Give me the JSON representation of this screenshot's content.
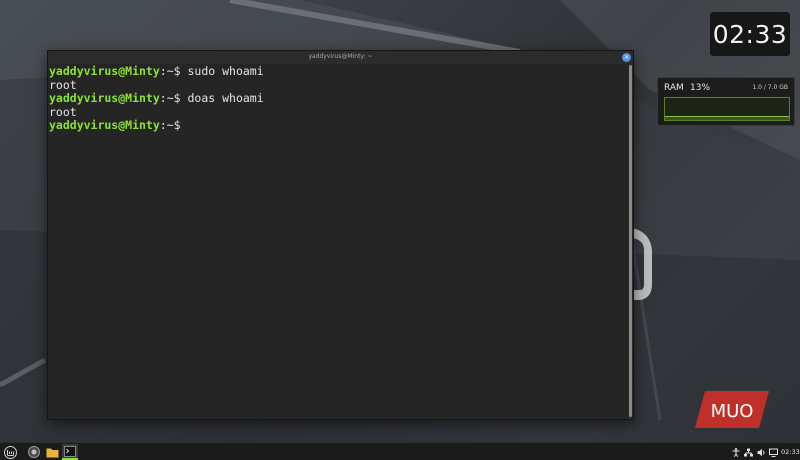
{
  "desktop": {
    "clock_widget": {
      "time": "02:33"
    },
    "ram_widget": {
      "label": "RAM",
      "percent": "13%",
      "amount": "1.0 / 7.0 GB",
      "usage_fraction": 0.13
    },
    "watermark": {
      "text": "MUO"
    }
  },
  "terminal": {
    "title": "yaddyvirus@Minty: ~",
    "lines": [
      {
        "user": "yaddyvirus@Minty",
        "path": ":~$",
        "command": " sudo whoami"
      },
      {
        "output": "root"
      },
      {
        "user": "yaddyvirus@Minty",
        "path": ":~$",
        "command": " doas whoami"
      },
      {
        "output": "root"
      },
      {
        "user": "yaddyvirus@Minty",
        "path": ":~$",
        "command": ""
      }
    ]
  },
  "taskbar": {
    "menu_icon": "mint-menu-icon",
    "launchers": [
      "firefox-icon",
      "folder-icon",
      "terminal-icon"
    ],
    "tray": [
      "accessibility-icon",
      "network-icon",
      "volume-icon",
      "display-icon"
    ],
    "clock": "02:33"
  },
  "colors": {
    "prompt_user": "#8ae234",
    "terminal_bg": "#252525",
    "accent": "#5294e2",
    "watermark": "#c0302a"
  }
}
